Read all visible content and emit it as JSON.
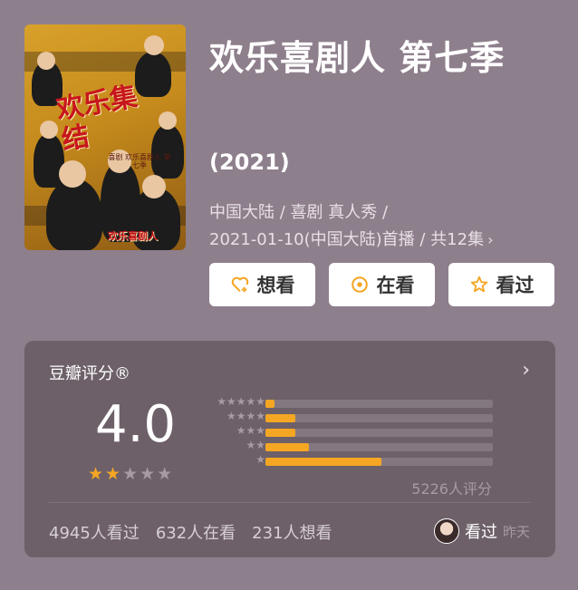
{
  "poster": {
    "title_text": "欢乐集结",
    "subtitle_text": "喜剧 欢乐喜剧人 第七季",
    "corner_text": "欢乐喜剧人"
  },
  "movie": {
    "title": "欢乐喜剧人 第七季",
    "year": "(2021)",
    "meta_line1": "中国大陆 / 喜剧 真人秀 /",
    "meta_line2": "2021-01-10(中国大陆)首播 / 共12集",
    "meta_chevron": "›"
  },
  "actions": {
    "want": "想看",
    "watching": "在看",
    "watched": "看过"
  },
  "rating": {
    "header": "豆瓣评分®",
    "chevron": "›",
    "score": "4.0",
    "stars_on": "★★",
    "stars_off": "★★★",
    "count": "5226人评分",
    "distribution": [
      {
        "stars": "★★★★★",
        "percent": 4
      },
      {
        "stars": "★★★★",
        "percent": 13
      },
      {
        "stars": "★★★",
        "percent": 13
      },
      {
        "stars": "★★",
        "percent": 19
      },
      {
        "stars": "★",
        "percent": 51
      }
    ],
    "accent": "#f5a623"
  },
  "footer": {
    "watched": "4945人看过",
    "watching": "632人在看",
    "want": "231人想看",
    "recent_action": "看过",
    "recent_time": "昨天"
  }
}
